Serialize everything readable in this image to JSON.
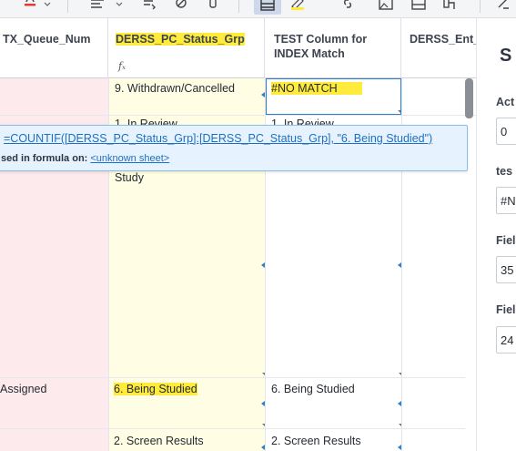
{
  "toolbar": {
    "icons": [
      "text-color-icon",
      "align-icon",
      "format-painter-icon",
      "clear-format-icon",
      "paint-icon",
      "grid-view-icon",
      "highlight-icon",
      "link-icon",
      "image-icon",
      "card-view-icon",
      "branch-icon",
      "more-icon"
    ]
  },
  "columns": {
    "col1": "TX_Queue_Num",
    "col2": "DERSS_PC_Status_Grp",
    "col3": "TEST Column for INDEX Match",
    "col4": "DERSS_Ent_"
  },
  "rows": {
    "r1": {
      "status": "9. Withdrawn/Cancelled",
      "test": "#NO MATCH"
    },
    "r2": {
      "status_extra": "Study"
    },
    "r3": {
      "queue": "Assigned",
      "status": "6. Being Studied",
      "test": "6. Being Studied"
    },
    "r4": {
      "status": "2. Screen Results",
      "test": "2. Screen Results"
    }
  },
  "tooltip": {
    "formula": "=COUNTIF([DERSS_PC_Status_Grp]:[DERSS_PC_Status_Grp], \"6. Being Studied\")",
    "used_label": "sed in formula on:",
    "sheet_link": "<unknown sheet>"
  },
  "panel": {
    "title": "S",
    "field1_label": "Act",
    "field1_value": "0",
    "field2_label": "tes",
    "field2_value": "#N",
    "field3_label": "Fiel",
    "field3_value": "35",
    "field4_label": "Fiel",
    "field4_value": "24"
  },
  "colors": {
    "highlight": "#ffeb3b",
    "pink_column": "#fdeaec",
    "yellow_column": "#fffde3",
    "link": "#1f6fbf"
  }
}
